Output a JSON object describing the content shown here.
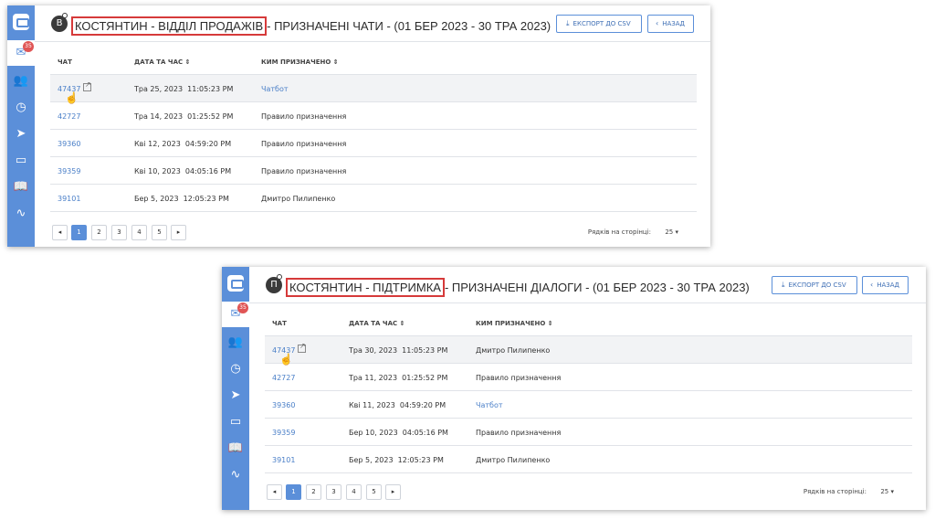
{
  "windows": [
    {
      "avatar_letter": "В",
      "title_highlight": "КОСТЯНТИН - ВІДДІЛ ПРОДАЖІВ",
      "title_rest": "- ПРИЗНАЧЕНІ ЧАТИ - (01 БЕР 2023 - 30 ТРА 2023)",
      "badge": "35",
      "export_label": "ЕКСПОРТ ДО CSV",
      "back_label": "НАЗАД",
      "columns": {
        "chat": "ЧАТ",
        "datetime": "ДАТА ТА ЧАС",
        "assigned_by": "КИМ ПРИЗНАЧЕНО"
      },
      "rows": [
        {
          "id": "47437",
          "date": "Тра 25, 2023",
          "time": "11:05:23 PM",
          "by": "Чатбот",
          "by_link": true
        },
        {
          "id": "42727",
          "date": "Тра 14, 2023",
          "time": "01:25:52 PM",
          "by": "Правило призначення",
          "by_link": false
        },
        {
          "id": "39360",
          "date": "Кві 12, 2023",
          "time": "04:59:20 PM",
          "by": "Правило призначення",
          "by_link": false
        },
        {
          "id": "39359",
          "date": "Кві 10, 2023",
          "time": "04:05:16 PM",
          "by": "Правило призначення",
          "by_link": false
        },
        {
          "id": "39101",
          "date": "Бер 5, 2023",
          "time": "12:05:23 PM",
          "by": "Дмитро Пилипенко",
          "by_link": false
        }
      ],
      "pages": [
        "1",
        "2",
        "3",
        "4",
        "5"
      ],
      "rows_per_page_label": "Рядків на сторінці:",
      "rows_per_page_value": "25"
    },
    {
      "avatar_letter": "П",
      "title_highlight": "КОСТЯНТИН - ПІДТРИМКА",
      "title_rest": "- ПРИЗНАЧЕНІ ДІАЛОГИ - (01 БЕР 2023 - 30 ТРА 2023)",
      "badge": "35",
      "export_label": "ЕКСПОРТ ДО CSV",
      "back_label": "НАЗАД",
      "columns": {
        "chat": "ЧАТ",
        "datetime": "ДАТА ТА ЧАС",
        "assigned_by": "КИМ ПРИЗНАЧЕНО"
      },
      "rows": [
        {
          "id": "47437",
          "date": "Тра 30, 2023",
          "time": "11:05:23 PM",
          "by": "Дмитро Пилипенко",
          "by_link": false
        },
        {
          "id": "42727",
          "date": "Тра 11, 2023",
          "time": "01:25:52 PM",
          "by": "Правило призначення",
          "by_link": false
        },
        {
          "id": "39360",
          "date": "Кві 11, 2023",
          "time": "04:59:20 PM",
          "by": "Чатбот",
          "by_link": true
        },
        {
          "id": "39359",
          "date": "Бер 10, 2023",
          "time": "04:05:16 PM",
          "by": "Правило призначення",
          "by_link": false
        },
        {
          "id": "39101",
          "date": "Бер 5, 2023",
          "time": "12:05:23 PM",
          "by": "Дмитро Пилипенко",
          "by_link": false
        }
      ],
      "pages": [
        "1",
        "2",
        "3",
        "4",
        "5"
      ],
      "rows_per_page_label": "Рядків на сторінці:",
      "rows_per_page_value": "25"
    }
  ],
  "icons": {
    "sort": "⇕",
    "prev": "◂",
    "next": "▸",
    "dropdown": "▾",
    "back": "‹",
    "download": "⤓",
    "cursor": "☝"
  },
  "sidebar_icons": [
    "inbox-icon",
    "contacts-icon",
    "history-icon",
    "send-icon",
    "wallet-icon",
    "book-icon",
    "activity-icon"
  ],
  "colors": {
    "accent": "#5b8fd9",
    "highlight_border": "#d63a3a",
    "link": "#4a7fc8"
  }
}
